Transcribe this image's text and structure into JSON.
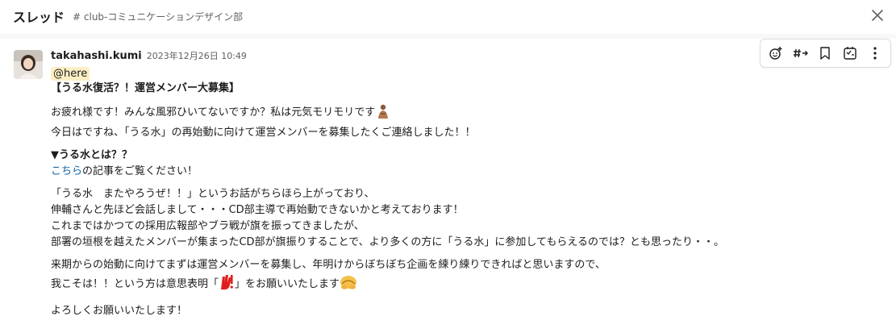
{
  "header": {
    "title": "スレッド",
    "channel": "# club-コミュニケーションデザイン部"
  },
  "toolbar": {
    "icons": [
      "add-reaction-icon",
      "reply-in-channel-icon",
      "bookmark-icon",
      "forward-icon",
      "more-icon"
    ]
  },
  "message": {
    "author": "takahashi.kumi",
    "timestamp": "2023年12月26日 10:49",
    "mention": "@here",
    "heading": "【うる水復活？！運営メンバー大募集】",
    "p1_line1": "お疲れ様です！みんな風邪ひいてないですか？私は元気モリモリです",
    "p1_line2": "今日はですね、「うる水」の再始動に向けて運営メンバーを募集したくご連絡しました！！",
    "section_title": "▼うる水とは？？",
    "link_text": "こちら",
    "link_suffix": "の記事をご覧ください！",
    "p3_line1": "「うる水　またやろうぜ！！」というお話がちらほら上がっており、",
    "p3_line2": "伸輔さんと先ほど会話しまして・・・CD部主導で再始動できないかと考えております！",
    "p3_line3": "これまではかつての採用広報部やブラ戦が旗を振ってきましたが、",
    "p3_line4": "部署の垣根を越えたメンバーが集まったCD部が旗振りすることで、より多くの方に「うる水」に参加してもらえるのでは？とも思ったり・・。",
    "p4_line1": "来期からの始動に向けてまずは運営メンバーを募集し、年明けからぼちぼち企画を練り練りできればと思いますので、",
    "p4_line2_a": "我こそは！！という方は意思表明「",
    "p4_line2_b": "」をお願いいたします",
    "closing": "よろしくお願いいたします！"
  }
}
